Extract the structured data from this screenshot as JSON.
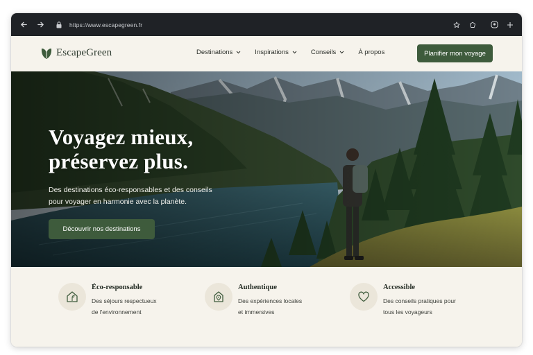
{
  "browser": {
    "url": "https://www.escapegreen.fr",
    "icons": [
      "back-arrow-icon",
      "forward-arrow-icon",
      "lock-icon",
      "bookmark-icon",
      "extensions-icon",
      "profile-icon",
      "menu-icon"
    ]
  },
  "header": {
    "brand": "EscapeGreen",
    "nav": [
      {
        "label": "Destinations",
        "dropdown": true
      },
      {
        "label": "Inspirations",
        "dropdown": true
      },
      {
        "label": "Conseils",
        "dropdown": true
      },
      {
        "label": "À propos",
        "dropdown": false
      }
    ],
    "cta_label": "Planifier mon voyage"
  },
  "hero": {
    "title_line1": "Voyagez mieux,",
    "title_line2": "préservez plus.",
    "subtitle_line1": "Des destinations éco-responsables et des conseils",
    "subtitle_line2": "pour voyager en harmonie avec la planète.",
    "cta_label": "Découvrir nos destinations"
  },
  "features": [
    {
      "title": "Éco-responsable",
      "desc_line1": "Des séjours respectueux",
      "desc_line2": "de l'environnement",
      "icon": "eco-house-icon"
    },
    {
      "title": "Authentique",
      "desc_line1": "Des expériences locales",
      "desc_line2": "et immersives",
      "icon": "location-home-icon"
    },
    {
      "title": "Accessible",
      "desc_line1": "Des conseils pratiques pour",
      "desc_line2": "tous les voyageurs",
      "icon": "heart-icon"
    }
  ],
  "colors": {
    "accent": "#3e5b3c",
    "background": "#f6f3ec",
    "chrome": "#1f2226"
  }
}
